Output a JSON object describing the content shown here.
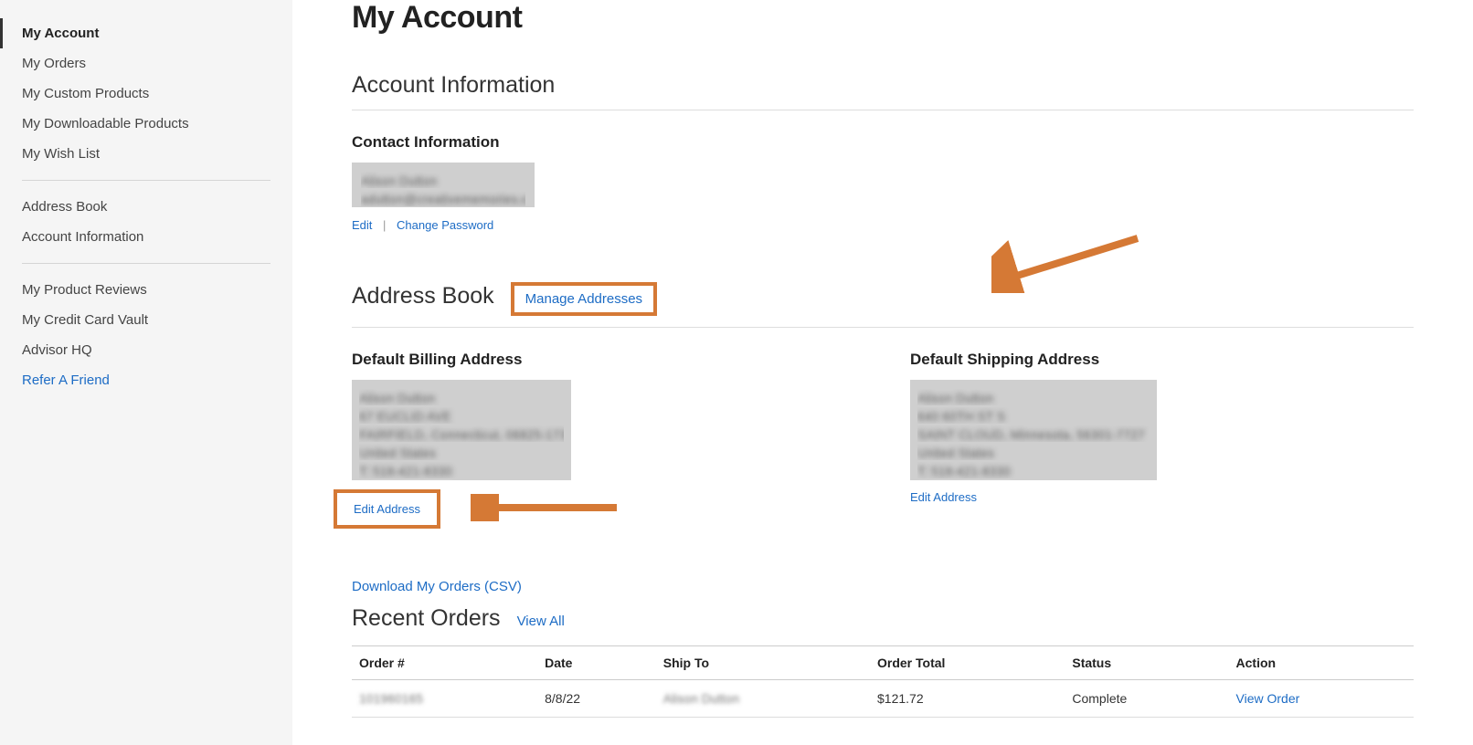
{
  "page_title": "My Account",
  "sidebar": {
    "groups": [
      [
        {
          "label": "My Account",
          "active": true,
          "link": false
        },
        {
          "label": "My Orders",
          "active": false,
          "link": false
        },
        {
          "label": "My Custom Products",
          "active": false,
          "link": false
        },
        {
          "label": "My Downloadable Products",
          "active": false,
          "link": false
        },
        {
          "label": "My Wish List",
          "active": false,
          "link": false
        }
      ],
      [
        {
          "label": "Address Book",
          "active": false,
          "link": false
        },
        {
          "label": "Account Information",
          "active": false,
          "link": false
        }
      ],
      [
        {
          "label": "My Product Reviews",
          "active": false,
          "link": false
        },
        {
          "label": "My Credit Card Vault",
          "active": false,
          "link": false
        },
        {
          "label": "Advisor HQ",
          "active": false,
          "link": false
        },
        {
          "label": "Refer A Friend",
          "active": false,
          "link": true
        }
      ]
    ]
  },
  "account_info": {
    "heading": "Account Information",
    "contact_heading": "Contact Information",
    "edit_label": "Edit",
    "change_password_label": "Change Password"
  },
  "address_book": {
    "heading": "Address Book",
    "manage_label": "Manage Addresses",
    "billing_heading": "Default Billing Address",
    "shipping_heading": "Default Shipping Address",
    "edit_address_label": "Edit Address"
  },
  "orders": {
    "download_label": "Download My Orders (CSV)",
    "heading": "Recent Orders",
    "view_all_label": "View All",
    "columns": {
      "order_num": "Order #",
      "date": "Date",
      "ship_to": "Ship To",
      "order_total": "Order Total",
      "status": "Status",
      "action": "Action"
    },
    "rows": [
      {
        "order_num": "101960165",
        "date": "8/8/22",
        "ship_to": "Alison Dutton",
        "order_total": "$121.72",
        "status": "Complete",
        "action": "View Order"
      }
    ]
  },
  "annotations": {
    "color": "#d57935"
  }
}
